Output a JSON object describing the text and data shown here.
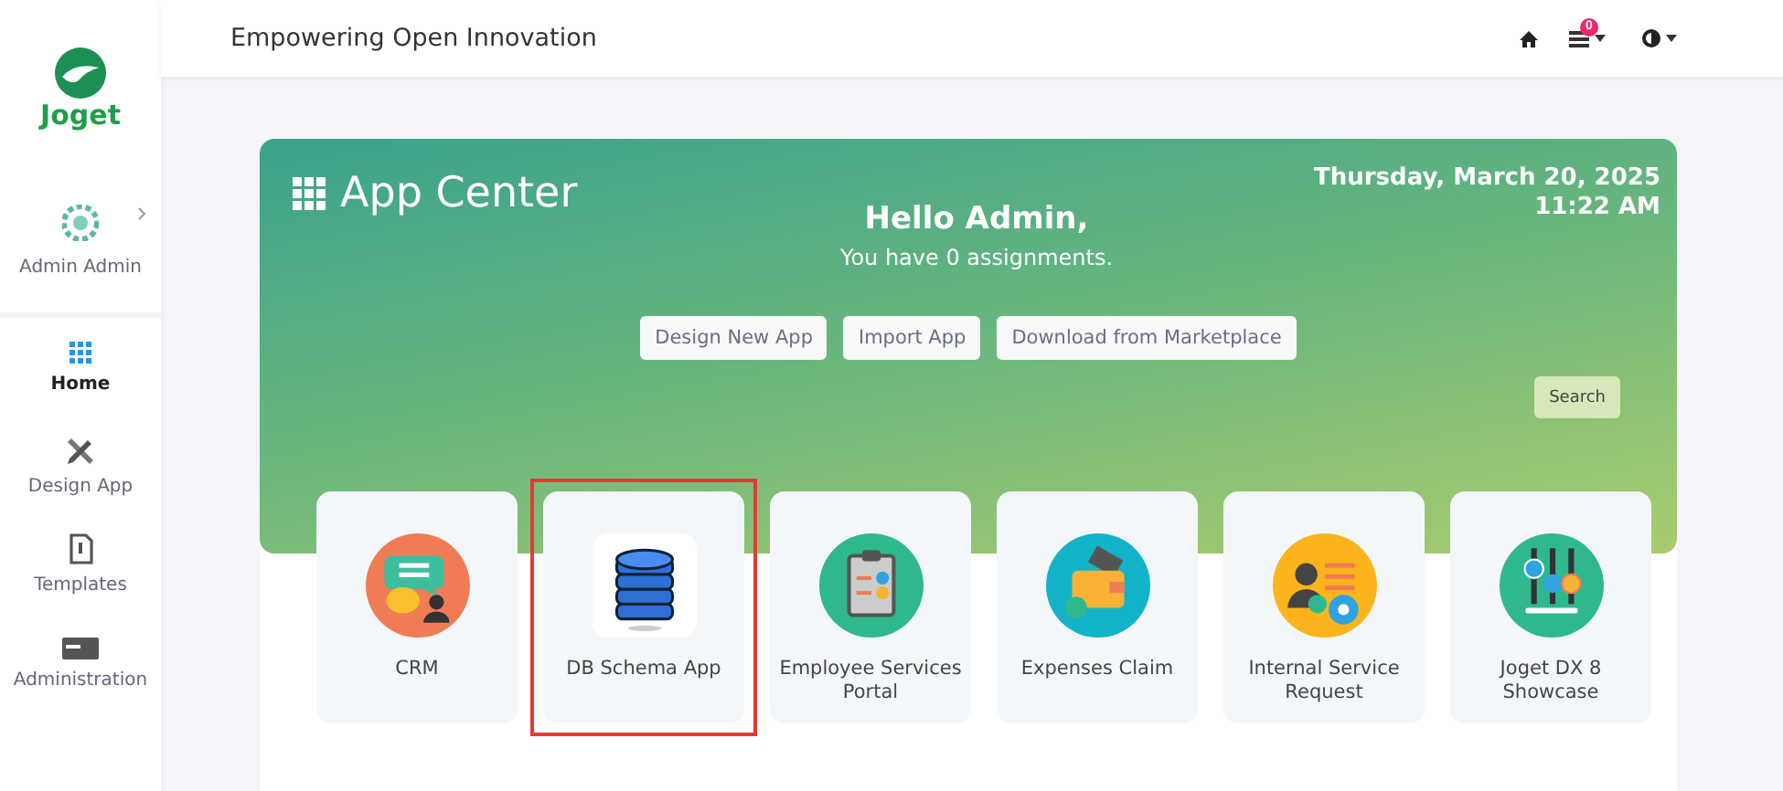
{
  "sidebar": {
    "logo": "Joget",
    "user": {
      "name": "Admin Admin"
    },
    "items": [
      {
        "label": "Home",
        "kind": "grid",
        "selected": true
      },
      {
        "label": "Design App",
        "kind": "tools",
        "selected": false
      },
      {
        "label": "Templates",
        "kind": "file",
        "selected": false
      },
      {
        "label": "Administration",
        "kind": "card",
        "selected": false
      }
    ]
  },
  "header": {
    "title": "Empowering Open Innovation",
    "notification_count": "0"
  },
  "banner": {
    "title": "App Center",
    "date": "Thursday, March 20, 2025",
    "time": "11:22 AM",
    "greeting": "Hello Admin,",
    "message": "You have 0 assignments.",
    "buttons": [
      "Design New App",
      "Import App",
      "Download from Marketplace"
    ],
    "search_button": "Search"
  },
  "apps": [
    {
      "name": "CRM",
      "kind": "chat",
      "selected": false
    },
    {
      "name": "DB Schema App",
      "kind": "database",
      "selected": true
    },
    {
      "name": "Employee Services Portal",
      "kind": "clipboard",
      "selected": false
    },
    {
      "name": "Expenses Claim",
      "kind": "wallet",
      "selected": false
    },
    {
      "name": "Internal Service Request",
      "kind": "person",
      "selected": false
    },
    {
      "name": "Joget DX 8 Showcase",
      "kind": "sliders",
      "selected": false
    }
  ]
}
